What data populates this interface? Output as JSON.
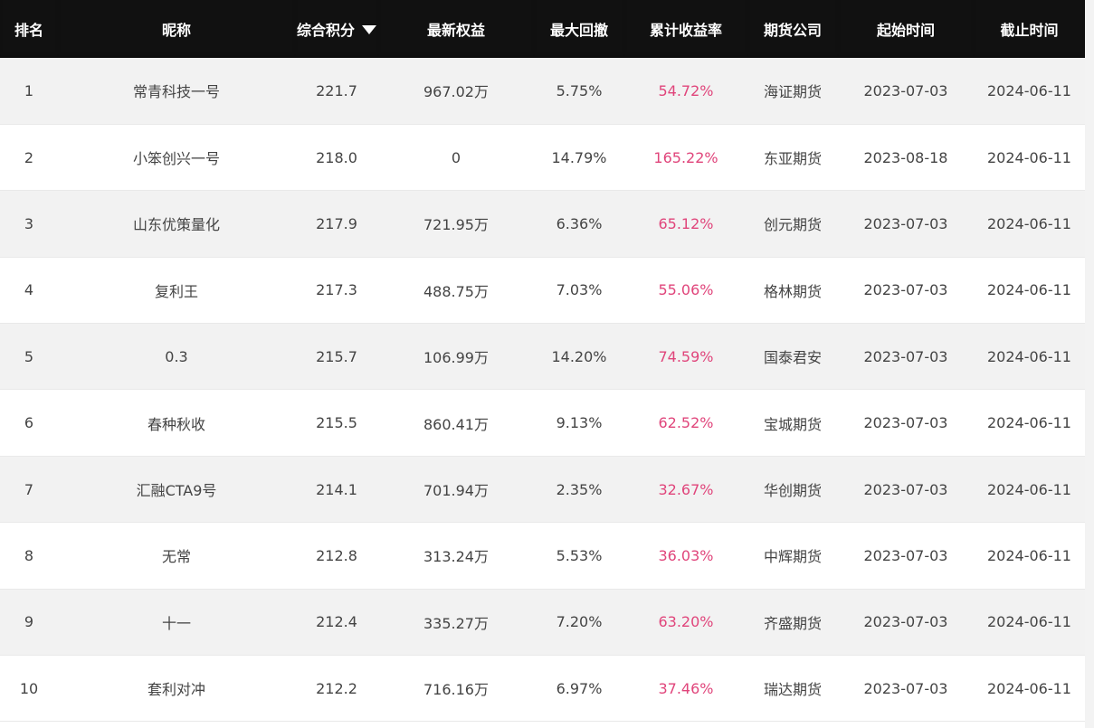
{
  "table": {
    "headers": {
      "rank": "排名",
      "name": "昵称",
      "score": "综合积分",
      "equity": "最新权益",
      "drawdown": "最大回撤",
      "return": "累计收益率",
      "firm": "期货公司",
      "start": "起始时间",
      "end": "截止时间"
    },
    "sort_icon": "triangle-down-icon",
    "return_color": "#e0457b",
    "header_bg": "#111111",
    "rows": [
      {
        "rank": "1",
        "name": "常青科技一号",
        "score": "221.7",
        "equity": "967.02万",
        "drawdown": "5.75%",
        "return": "54.72%",
        "firm": "海证期货",
        "start": "2023-07-03",
        "end": "2024-06-11"
      },
      {
        "rank": "2",
        "name": "小笨创兴一号",
        "score": "218.0",
        "equity": "0",
        "drawdown": "14.79%",
        "return": "165.22%",
        "firm": "东亚期货",
        "start": "2023-08-18",
        "end": "2024-06-11"
      },
      {
        "rank": "3",
        "name": "山东优策量化",
        "score": "217.9",
        "equity": "721.95万",
        "drawdown": "6.36%",
        "return": "65.12%",
        "firm": "创元期货",
        "start": "2023-07-03",
        "end": "2024-06-11"
      },
      {
        "rank": "4",
        "name": "复利王",
        "score": "217.3",
        "equity": "488.75万",
        "drawdown": "7.03%",
        "return": "55.06%",
        "firm": "格林期货",
        "start": "2023-07-03",
        "end": "2024-06-11"
      },
      {
        "rank": "5",
        "name": "0.3",
        "score": "215.7",
        "equity": "106.99万",
        "drawdown": "14.20%",
        "return": "74.59%",
        "firm": "国泰君安",
        "start": "2023-07-03",
        "end": "2024-06-11"
      },
      {
        "rank": "6",
        "name": "春种秋收",
        "score": "215.5",
        "equity": "860.41万",
        "drawdown": "9.13%",
        "return": "62.52%",
        "firm": "宝城期货",
        "start": "2023-07-03",
        "end": "2024-06-11"
      },
      {
        "rank": "7",
        "name": "汇融CTA9号",
        "score": "214.1",
        "equity": "701.94万",
        "drawdown": "2.35%",
        "return": "32.67%",
        "firm": "华创期货",
        "start": "2023-07-03",
        "end": "2024-06-11"
      },
      {
        "rank": "8",
        "name": "无常",
        "score": "212.8",
        "equity": "313.24万",
        "drawdown": "5.53%",
        "return": "36.03%",
        "firm": "中辉期货",
        "start": "2023-07-03",
        "end": "2024-06-11"
      },
      {
        "rank": "9",
        "name": "十一",
        "score": "212.4",
        "equity": "335.27万",
        "drawdown": "7.20%",
        "return": "63.20%",
        "firm": "齐盛期货",
        "start": "2023-07-03",
        "end": "2024-06-11"
      },
      {
        "rank": "10",
        "name": "套利对冲",
        "score": "212.2",
        "equity": "716.16万",
        "drawdown": "6.97%",
        "return": "37.46%",
        "firm": "瑞达期货",
        "start": "2023-07-03",
        "end": "2024-06-11"
      }
    ]
  }
}
